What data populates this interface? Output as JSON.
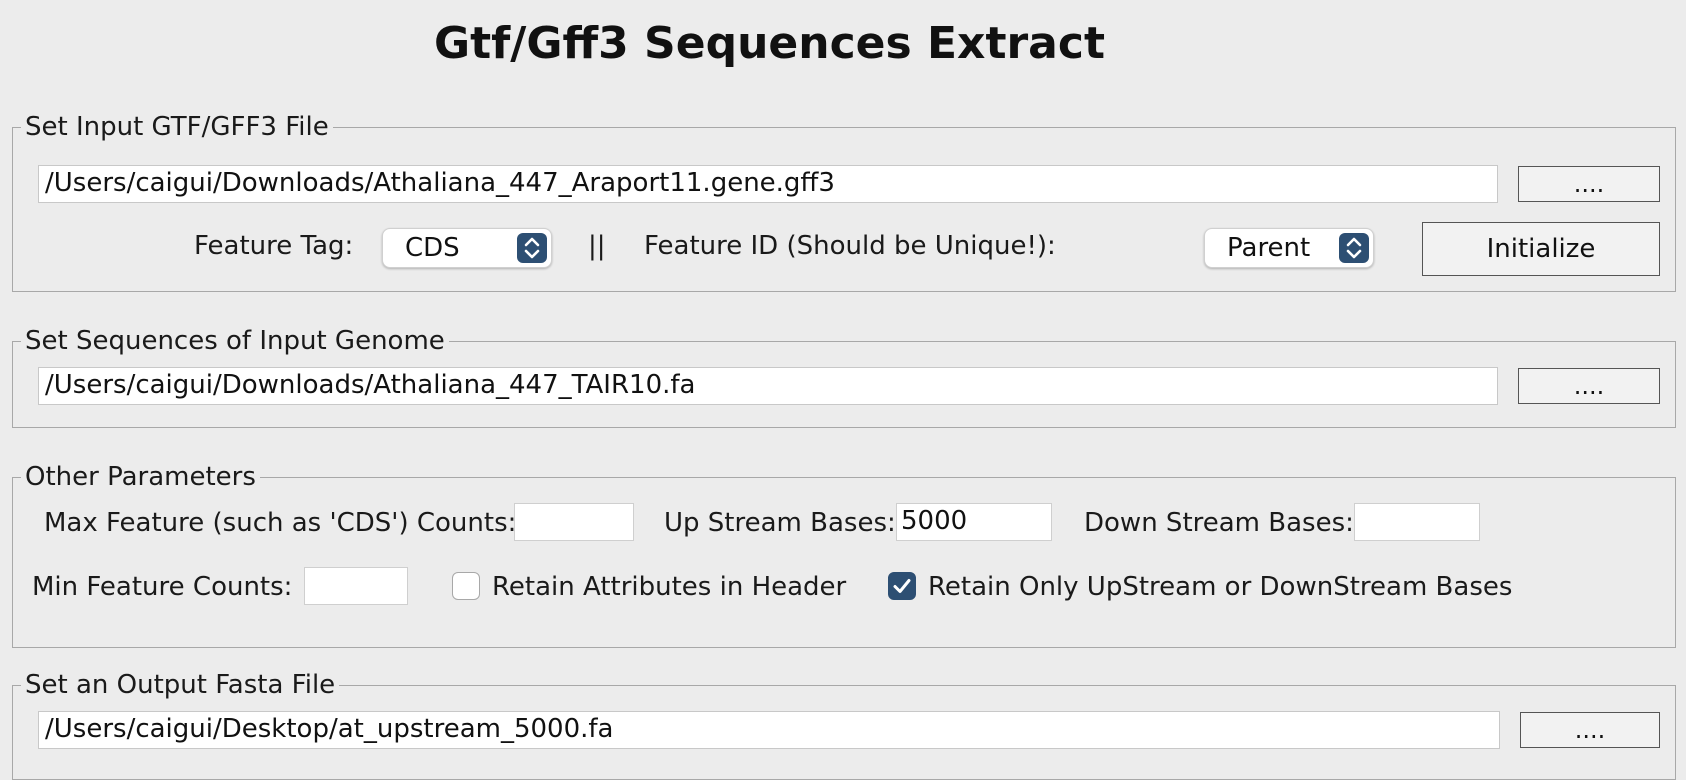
{
  "window": {
    "title": "Gtf/Gff3 Sequences Extract"
  },
  "input_gtf": {
    "legend": "Set Input GTF/GFF3 File",
    "path": "/Users/caigui/Downloads/Athaliana_447_Araport11.gene.gff3",
    "browse_label": "....",
    "feature_tag_label": "Feature Tag:",
    "feature_tag_value": "CDS",
    "separator": "||",
    "feature_id_label": "Feature ID (Should be Unique!):",
    "feature_id_value": "Parent",
    "initialize_label": "Initialize"
  },
  "genome": {
    "legend": "Set Sequences of Input Genome",
    "path": "/Users/caigui/Downloads/Athaliana_447_TAIR10.fa",
    "browse_label": "...."
  },
  "other": {
    "legend": "Other Parameters",
    "max_feature_label": "Max Feature (such as 'CDS') Counts:",
    "max_feature_value": "",
    "upstream_label": "Up Stream Bases:",
    "upstream_value": "5000",
    "downstream_label": "Down Stream Bases:",
    "downstream_value": "",
    "min_feature_label": "Min Feature Counts:",
    "min_feature_value": "",
    "retain_attributes_label": "Retain Attributes in Header",
    "retain_attributes_checked": false,
    "retain_only_label": "Retain Only UpStream or DownStream Bases",
    "retain_only_checked": true
  },
  "output": {
    "legend": "Set an Output Fasta File",
    "path": "/Users/caigui/Desktop/at_upstream_5000.fa",
    "browse_label": "...."
  },
  "colors": {
    "accent": "#2d4f73",
    "background": "#ececec"
  }
}
